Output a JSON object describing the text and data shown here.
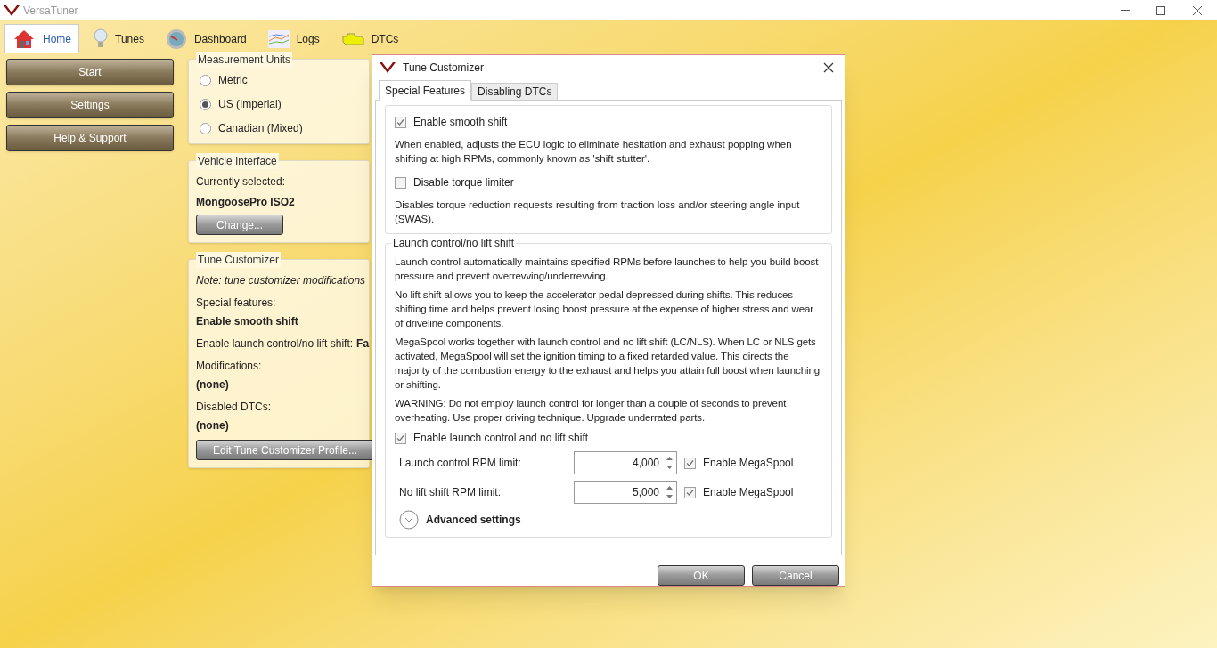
{
  "window": {
    "title": "VersaTuner"
  },
  "nav_tabs": [
    {
      "label": "Home",
      "selected": true
    },
    {
      "label": "Tunes",
      "selected": false
    },
    {
      "label": "Dashboard",
      "selected": false
    },
    {
      "label": "Logs",
      "selected": false
    },
    {
      "label": "DTCs",
      "selected": false
    }
  ],
  "side_buttons": [
    "Start",
    "Settings",
    "Help & Support"
  ],
  "measurement_units": {
    "title": "Measurement Units",
    "options": [
      {
        "label": "Metric",
        "selected": false
      },
      {
        "label": "US (Imperial)",
        "selected": true
      },
      {
        "label": "Canadian (Mixed)",
        "selected": false
      }
    ]
  },
  "vehicle_interface": {
    "title": "Vehicle Interface",
    "label": "Currently selected:",
    "value": "MongoosePro ISO2",
    "button": "Change..."
  },
  "tune_customizer_panel": {
    "title": "Tune Customizer",
    "note": "Note: tune customizer modifications",
    "special_label": "Special features:",
    "special_value": "Enable smooth shift",
    "launch_label": "Enable launch control/no lift shift:",
    "launch_value": "Fa",
    "mods_label": "Modifications:",
    "mods_value": "(none)",
    "dtcs_label": "Disabled DTCs:",
    "dtcs_value": "(none)",
    "button": "Edit Tune Customizer Profile..."
  },
  "dialog": {
    "title": "Tune Customizer",
    "tabs": [
      {
        "label": "Special Features",
        "selected": true
      },
      {
        "label": "Disabling DTCs",
        "selected": false
      }
    ],
    "features": [
      {
        "label": "Enable smooth shift",
        "checked": true,
        "description": "When enabled, adjusts the ECU logic to eliminate hesitation and exhaust popping when shifting at high RPMs, commonly known as 'shift stutter'."
      },
      {
        "label": "Disable torque limiter",
        "checked": false,
        "description": "Disables torque reduction requests resulting from traction loss and/or steering angle input (SWAS)."
      }
    ],
    "launch_group": {
      "title": "Launch control/no lift shift",
      "paragraphs": [
        "Launch control automatically maintains specified RPMs before launches to help you build boost pressure and prevent overrevving/underrevving.",
        "No lift shift allows you to keep the accelerator pedal depressed during shifts. This reduces shifting time and helps prevent losing boost pressure at the expense of higher stress and wear of driveline components.",
        "MegaSpool works together with launch control and no lift shift (LC/NLS). When LC or NLS gets activated, MegaSpool will set the ignition timing to a fixed retarded value. This directs the majority of the combustion energy to the exhaust and helps you attain full boost when launching or shifting.",
        "WARNING: Do not employ launch control for longer than a couple of seconds to prevent overheating. Use proper driving technique. Upgrade underrated parts."
      ],
      "enable": {
        "label": "Enable launch control and no lift shift",
        "checked": true
      },
      "limits": [
        {
          "label": "Launch control RPM limit:",
          "value": "4,000",
          "megaspool": {
            "label": "Enable MegaSpool",
            "checked": true
          }
        },
        {
          "label": "No lift shift RPM limit:",
          "value": "5,000",
          "megaspool": {
            "label": "Enable MegaSpool",
            "checked": true
          }
        }
      ],
      "advanced": {
        "label": "Advanced settings",
        "expanded": false
      }
    },
    "buttons": [
      "OK",
      "Cancel"
    ]
  }
}
